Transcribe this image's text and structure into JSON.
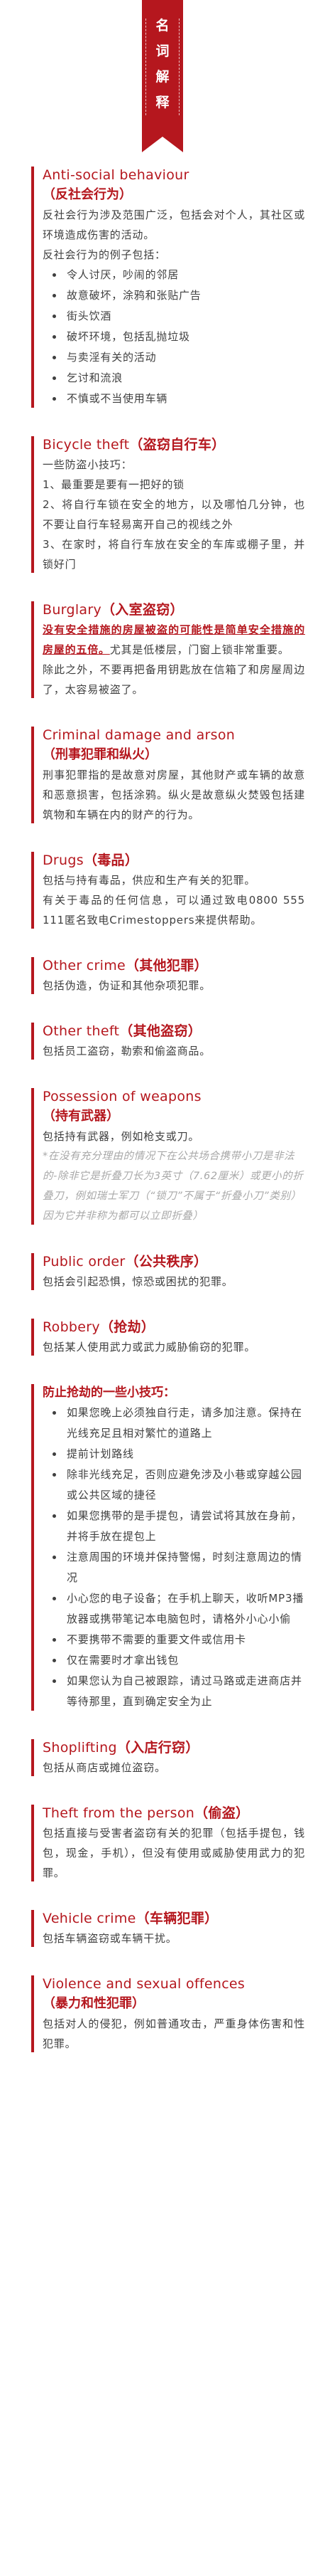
{
  "banner": [
    "名",
    "词",
    "解",
    "释"
  ],
  "sections": {
    "antisocial": {
      "title_en": "Anti-social behaviour",
      "title_cn": "（反社会行为）",
      "desc": "反社会行为涉及范围广泛，包括会对个人，其社区或环境造成伤害的活动。",
      "examples_intro": "反社会行为的例子包括：",
      "items": [
        "令人讨厌，吵闹的邻居",
        "故意破坏，涂鸦和张贴广告",
        "街头饮酒",
        "破坏环境，包括乱抛垃圾",
        "与卖淫有关的活动",
        "乞讨和流浪",
        "不慎或不当使用车辆"
      ]
    },
    "bicycle": {
      "title_en": "Bicycle theft",
      "title_cn": "（盗窃自行车）",
      "intro": "一些防盗小技巧：",
      "tips": [
        "1、最重要是要有一把好的锁",
        "2、将自行车锁在安全的地方，以及哪怕几分钟，也不要让自行车轻易离开自己的视线之外",
        "3、在家时，将自行车放在安全的车库或棚子里，并锁好门"
      ]
    },
    "burglary": {
      "title_en": "Burglary",
      "title_cn": "（入室盗窃）",
      "strong": "没有安全措施的房屋被盗的可能性是简单安全措施的房屋的五倍。",
      "after_strong": "尤其是低楼层，门窗上锁非常重要。",
      "desc2": "除此之外，不要再把备用钥匙放在信箱了和房屋周边了，太容易被盗了。"
    },
    "criminal": {
      "title_en": "Criminal damage and arson",
      "title_cn": "（刑事犯罪和纵火）",
      "desc": "刑事犯罪指的是故意对房屋，其他财产或车辆的故意和恶意损害，包括涂鸦。纵火是故意纵火焚毁包括建筑物和车辆在内的财产的行为。"
    },
    "drugs": {
      "title_en": "Drugs",
      "title_cn": "（毒品）",
      "desc": "包括与持有毒品，供应和生产有关的犯罪。",
      "desc2": "有关于毒品的任何信息，可以通过致电0800 555 111匿名致电Crimestoppers来提供帮助。"
    },
    "other_crime": {
      "title_en": "Other crime",
      "title_cn": "（其他犯罪）",
      "desc": "包括伪造，伪证和其他杂项犯罪。"
    },
    "other_theft": {
      "title_en": "Other theft",
      "title_cn": "（其他盗窃）",
      "desc": "包括员工盗窃，勒索和偷盗商品。"
    },
    "weapons": {
      "title_en": "Possession of weapons",
      "title_cn": "（持有武器）",
      "desc": "包括持有武器，例如枪支或刀。",
      "note": "*在没有充分理由的情况下在公共场合携带小刀是非法的-除非它是折叠刀长为3英寸（7.62厘米）或更小的折叠刀，例如瑞士军刀（“锁刀”不属于“折叠小刀”类别）因为它并非称为都可以立即折叠）"
    },
    "public_order": {
      "title_en": "Public order",
      "title_cn": "（公共秩序）",
      "desc": "包括会引起恐惧，惊恐或困扰的犯罪。"
    },
    "robbery": {
      "title_en": "Robbery",
      "title_cn": "（抢劫）",
      "desc": "包括某人使用武力或武力威胁偷窃的犯罪。"
    },
    "anti_robbery": {
      "title": "防止抢劫的一些小技巧：",
      "items": [
        "如果您晚上必须独自行走，请多加注意。保持在光线充足且相对繁忙的道路上",
        "提前计划路线",
        "除非光线充足，否则应避免涉及小巷或穿越公园或公共区域的捷径",
        "如果您携带的是手提包，请尝试将其放在身前，并将手放在提包上",
        "注意周围的环境并保持警惕，时刻注意周边的情况",
        "小心您的电子设备；在手机上聊天，收听MP3播放器或携带笔记本电脑包时，请格外小心小偷",
        "不要携带不需要的重要文件或信用卡",
        "仅在需要时才拿出钱包",
        "如果您认为自己被跟踪，请过马路或走进商店并等待那里，直到确定安全为止"
      ]
    },
    "shoplifting": {
      "title_en": "Shoplifting",
      "title_cn": "（入店行窃）",
      "desc": "包括从商店或摊位盗窃。"
    },
    "theft_person": {
      "title_en": "Theft from the person",
      "title_cn": "（偷盗）",
      "desc": "包括直接与受害者盗窃有关的犯罪（包括手提包，钱包，现金，手机），但没有使用或威胁使用武力的犯罪。"
    },
    "vehicle": {
      "title_en": "Vehicle crime",
      "title_cn": "（车辆犯罪）",
      "desc": "包括车辆盗窃或车辆干扰。"
    },
    "violence": {
      "title_en": "Violence and sexual offences",
      "title_cn": "（暴力和性犯罪）",
      "desc": "包括对人的侵犯，例如普通攻击，严重身体伤害和性犯罪。"
    }
  },
  "colors": {
    "accent": "#b5171e",
    "text": "#3f3f3f",
    "note": "#a8a8a8"
  }
}
